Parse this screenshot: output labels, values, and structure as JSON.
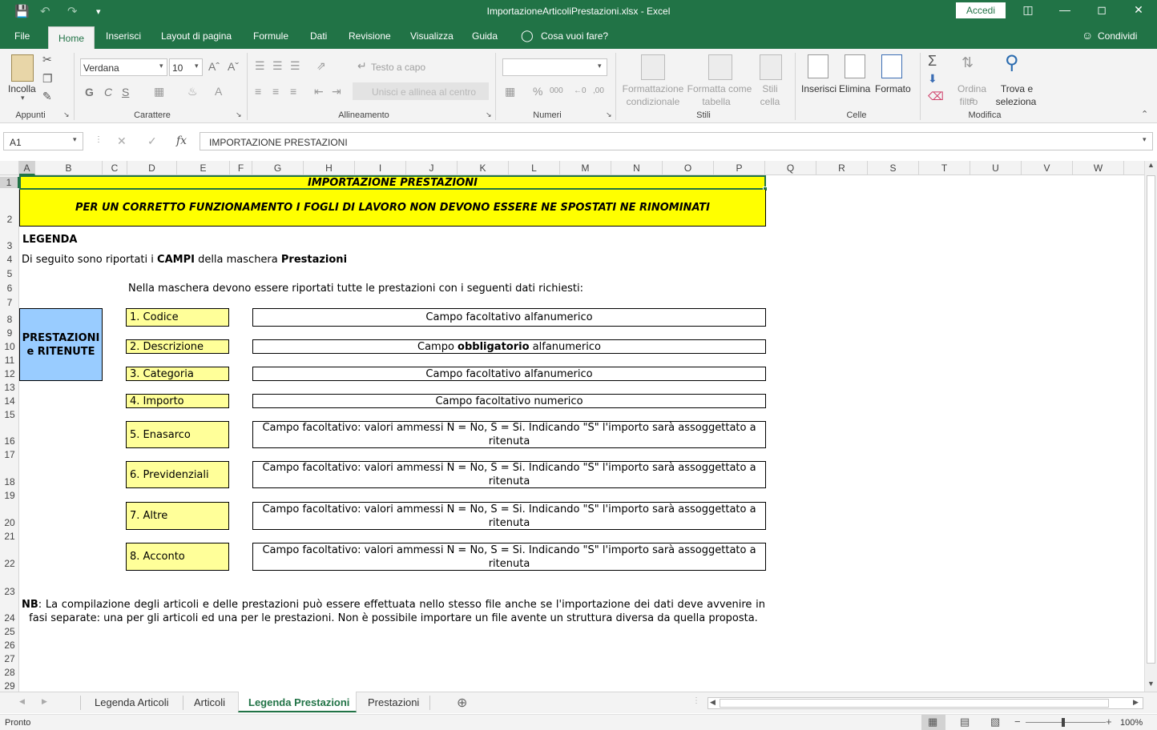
{
  "window": {
    "title": "ImportazioneArticoliPrestazioni.xlsx  -  Excel",
    "signin": "Accedi"
  },
  "ribbon_tabs": [
    "File",
    "Home",
    "Inserisci",
    "Layout di pagina",
    "Formule",
    "Dati",
    "Revisione",
    "Visualizza",
    "Guida"
  ],
  "tell_me": "Cosa vuoi fare?",
  "share": "Condividi",
  "ribbon": {
    "paste": "Incolla",
    "font_name": "Verdana",
    "font_size": "10",
    "wrap_text": "Testo a capo",
    "merge_center": "Unisci e allinea al centro",
    "cond_format": [
      "Formattazione",
      "condizionale"
    ],
    "format_table": [
      "Formatta come",
      "tabella"
    ],
    "cell_styles": [
      "Stili",
      "cella"
    ],
    "insert": "Inserisci",
    "delete": "Elimina",
    "format": "Formato",
    "sort_filter": [
      "Ordina e",
      "filtro"
    ],
    "find_select": [
      "Trova e",
      "seleziona"
    ],
    "groups": [
      "Appunti",
      "Carattere",
      "Allineamento",
      "Numeri",
      "Stili",
      "Celle",
      "Modifica"
    ]
  },
  "formula_bar": {
    "name_box": "A1",
    "fx": "fx",
    "content": "IMPORTAZIONE PRESTAZIONI"
  },
  "columns": [
    "A",
    "B",
    "C",
    "D",
    "E",
    "F",
    "G",
    "H",
    "I",
    "J",
    "K",
    "L",
    "M",
    "N",
    "O",
    "P",
    "Q",
    "R",
    "S",
    "T",
    "U",
    "V",
    "W"
  ],
  "rows": [
    "1",
    "2",
    "3",
    "4",
    "5",
    "6",
    "7",
    "8",
    "9",
    "10",
    "11",
    "12",
    "13",
    "14",
    "15",
    "16",
    "17",
    "18",
    "19",
    "20",
    "21",
    "22",
    "23",
    "24",
    "25",
    "26",
    "27",
    "28",
    "29"
  ],
  "sheet": {
    "title": "IMPORTAZIONE PRESTAZIONI",
    "warning": "PER UN CORRETTO FUNZIONAMENTO I FOGLI DI LAVORO NON DEVONO ESSERE NE SPOSTATI NE RINOMINATI",
    "legend": "LEGENDA",
    "intro_prefix": "Di seguito sono riportati i ",
    "intro_campi": "CAMPI",
    "intro_mid": " della maschera ",
    "intro_prestazioni": "Prestazioni",
    "mask_text": "Nella maschera devono essere riportati tutte le prestazioni con i seguenti dati richiesti:",
    "side_label": "PRESTAZIONI e RITENUTE",
    "fields": [
      {
        "label": "1. Codice",
        "desc": "Campo facoltativo alfanumerico"
      },
      {
        "label": "2. Descrizione",
        "desc_pre": "Campo ",
        "desc_bold": "obbligatorio",
        "desc_post": " alfanumerico"
      },
      {
        "label": "3. Categoria",
        "desc": "Campo facoltativo alfanumerico"
      },
      {
        "label": "4. Importo",
        "desc": "Campo facoltativo numerico"
      },
      {
        "label": "5. Enasarco",
        "desc": "Campo facoltativo: valori ammessi N = No, S = Si. Indicando \"S\" l'importo sarà assoggettato a ritenuta"
      },
      {
        "label": "6. Previdenziali",
        "desc": "Campo facoltativo: valori ammessi N = No, S = Si. Indicando \"S\" l'importo sarà assoggettato a ritenuta"
      },
      {
        "label": "7. Altre",
        "desc": "Campo facoltativo: valori ammessi N = No, S = Si. Indicando \"S\" l'importo sarà assoggettato a ritenuta"
      },
      {
        "label": "8. Acconto",
        "desc": "Campo facoltativo: valori ammessi N = No, S = Si. Indicando \"S\" l'importo sarà assoggettato a ritenuta"
      }
    ],
    "nb_bold": "NB",
    "nb_text": ": La compilazione degli articoli e delle prestazioni può essere effettuata nello stesso file anche se l'importazione dei dati deve avvenire in fasi separate: una per gli articoli ed una per le prestazioni. Non è possibile importare un file avente un struttura diversa da quella proposta."
  },
  "sheet_tabs": [
    "Legenda Articoli",
    "Articoli",
    "Legenda Prestazioni",
    "Prestazioni"
  ],
  "active_sheet": "Legenda Prestazioni",
  "status": {
    "ready": "Pronto",
    "zoom": "100%"
  },
  "colors": {
    "excel_green": "#217346",
    "yellow_header": "#ffff00",
    "yellow_field": "#ffff99",
    "blue_label": "#99ccff"
  }
}
